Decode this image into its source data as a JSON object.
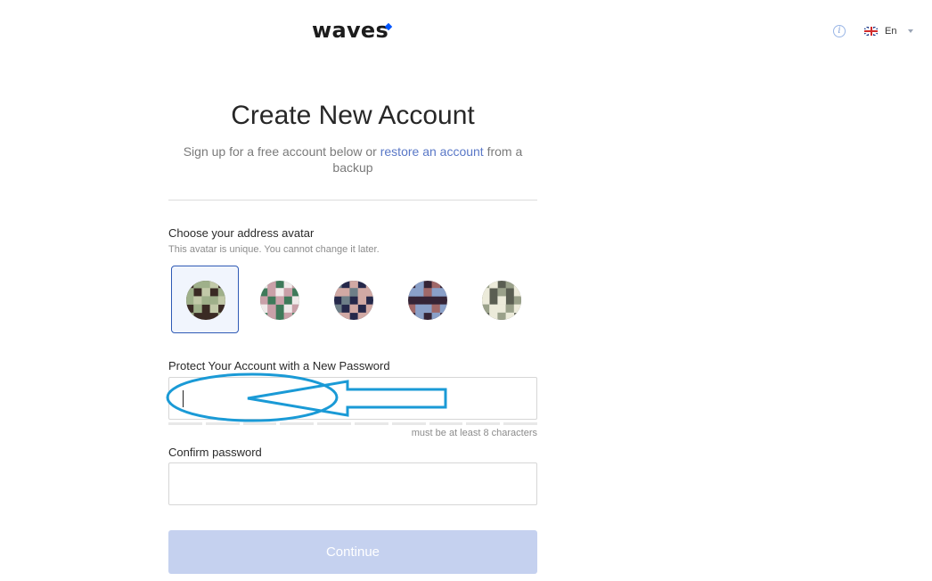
{
  "brand": {
    "logo_text": "waves",
    "accent_color": "#0055ff"
  },
  "header": {
    "info_icon": "info-icon",
    "language": {
      "flag_icon": "uk-flag-icon",
      "label": "En"
    }
  },
  "page": {
    "title": "Create New Account",
    "subtitle_before": "Sign up for a free account below or ",
    "subtitle_link": "restore an account",
    "subtitle_after": " from a backup"
  },
  "avatar_section": {
    "label": "Choose your address avatar",
    "hint": "This avatar is unique. You cannot change it later.",
    "selected_index": 0,
    "avatars": [
      {
        "name": "avatar-1",
        "colors": [
          "#3a2a24",
          "#9fb08a",
          "#c2c9a8"
        ]
      },
      {
        "name": "avatar-2",
        "colors": [
          "#3f7a5a",
          "#c9a0a8",
          "#f0eaea"
        ]
      },
      {
        "name": "avatar-3",
        "colors": [
          "#25284a",
          "#d1a9a4",
          "#6e7f88"
        ]
      },
      {
        "name": "avatar-4",
        "colors": [
          "#352436",
          "#8aa0c8",
          "#a06868"
        ]
      },
      {
        "name": "avatar-5",
        "colors": [
          "#5a5e52",
          "#ecebda",
          "#9aa18a"
        ]
      }
    ]
  },
  "password_section": {
    "label": "Protect Your Account with a New Password",
    "value": "",
    "min_hint": "must be at least 8 characters",
    "strength_segments": 10
  },
  "confirm_section": {
    "label": "Confirm password",
    "value": ""
  },
  "continue_button": {
    "label": "Continue",
    "enabled": false,
    "color": "#c5d1ef"
  },
  "annotation": {
    "color": "#1a9ad6"
  }
}
